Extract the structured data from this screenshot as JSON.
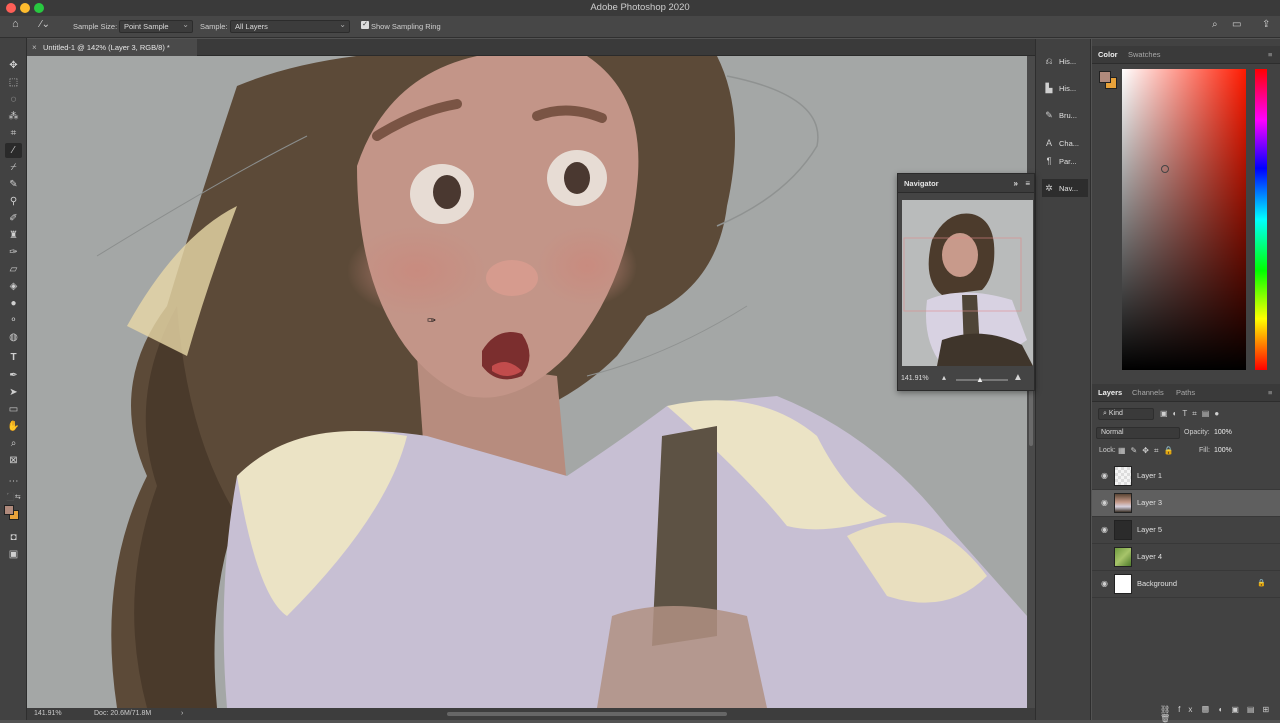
{
  "window": {
    "title": "Adobe Photoshop 2020"
  },
  "options_bar": {
    "sample_size_label": "Sample Size:",
    "sample_size_value": "Point Sample",
    "sample_label": "Sample:",
    "sample_value": "All Layers",
    "show_sampling_ring_label": "Show Sampling Ring",
    "show_sampling_ring_checked": true
  },
  "document": {
    "tab_title": "Untitled-1 @ 142% (Layer 3, RGB/8) *"
  },
  "status_bar": {
    "zoom": "141.91%",
    "doc_info": "Doc: 20.6M/71.8M"
  },
  "dock": {
    "items": [
      {
        "label": "His...",
        "icon": "history-icon"
      },
      {
        "label": "His...",
        "icon": "histogram-icon"
      },
      {
        "label": "Bru...",
        "icon": "brush-icon"
      },
      {
        "label": "Cha...",
        "icon": "character-icon"
      },
      {
        "label": "Par...",
        "icon": "paragraph-icon"
      },
      {
        "label": "Nav...",
        "icon": "navigator-icon"
      }
    ]
  },
  "navigator": {
    "title": "Navigator",
    "zoom": "141.91%"
  },
  "color_panel": {
    "tabs": [
      "Color",
      "Swatches"
    ],
    "foreground": "#b08a7c",
    "background": "#e8a23a"
  },
  "layers_panel": {
    "tabs": [
      "Layers",
      "Channels",
      "Paths"
    ],
    "filter_label": "Kind",
    "blend_mode": "Normal",
    "opacity_label": "Opacity:",
    "opacity_value": "100%",
    "lock_label": "Lock:",
    "fill_label": "Fill:",
    "fill_value": "100%",
    "layers": [
      {
        "name": "Layer 1",
        "visible": true,
        "selected": false,
        "thumb": "checker"
      },
      {
        "name": "Layer 3",
        "visible": true,
        "selected": true,
        "thumb": "portrait"
      },
      {
        "name": "Layer 5",
        "visible": true,
        "selected": false,
        "thumb": "dark"
      },
      {
        "name": "Layer 4",
        "visible": false,
        "selected": false,
        "thumb": "green"
      },
      {
        "name": "Background",
        "visible": true,
        "selected": false,
        "thumb": "white",
        "locked": true
      }
    ]
  }
}
